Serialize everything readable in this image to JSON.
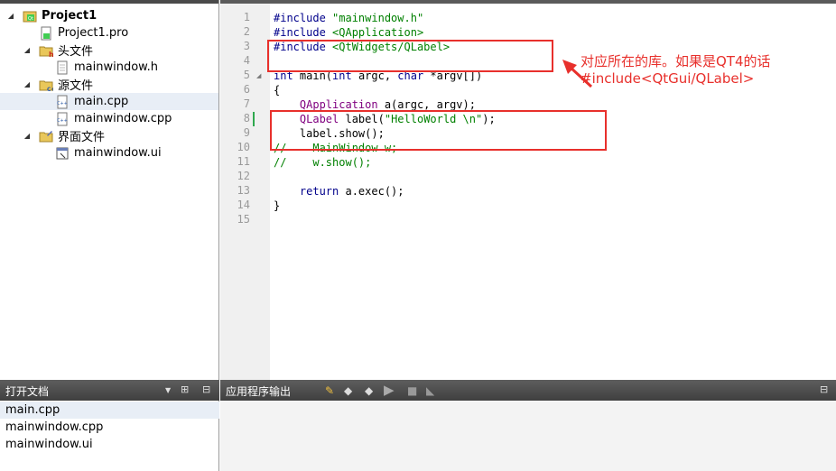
{
  "project_tree": {
    "items": [
      {
        "label": "Project1",
        "bold": true,
        "icon": "qt-project-icon"
      },
      {
        "label": "Project1.pro",
        "icon": "pro-file-icon"
      },
      {
        "label": "头文件",
        "icon": "header-folder-icon"
      },
      {
        "label": "mainwindow.h",
        "icon": "header-file-icon"
      },
      {
        "label": "源文件",
        "icon": "source-folder-icon"
      },
      {
        "label": "main.cpp",
        "icon": "cpp-file-icon"
      },
      {
        "label": "mainwindow.cpp",
        "icon": "cpp-file-icon"
      },
      {
        "label": "界面文件",
        "icon": "forms-folder-icon"
      },
      {
        "label": "mainwindow.ui",
        "icon": "ui-file-icon"
      }
    ]
  },
  "editor": {
    "line_numbers": [
      "1",
      "2",
      "3",
      "4",
      "5",
      "6",
      "7",
      "8",
      "9",
      "10",
      "11",
      "12",
      "13",
      "14",
      "15"
    ],
    "lines": [
      [
        {
          "t": "#include ",
          "c": "kw"
        },
        {
          "t": "\"mainwindow.h\"",
          "c": "str"
        }
      ],
      [
        {
          "t": "#include ",
          "c": "kw"
        },
        {
          "t": "<QApplication>",
          "c": "str"
        }
      ],
      [
        {
          "t": "#include ",
          "c": "kw"
        },
        {
          "t": "<QtWidgets/QLabel>",
          "c": "str"
        }
      ],
      [],
      [
        {
          "t": "int ",
          "c": "kw"
        },
        {
          "t": "main(",
          "c": "plain"
        },
        {
          "t": "int ",
          "c": "kw"
        },
        {
          "t": "argc, ",
          "c": "plain"
        },
        {
          "t": "char ",
          "c": "kw"
        },
        {
          "t": "*argv[])",
          "c": "plain"
        }
      ],
      [
        {
          "t": "{",
          "c": "plain"
        }
      ],
      [
        {
          "t": "    QApplication ",
          "c": "cls"
        },
        {
          "t": "a(argc, argv);",
          "c": "plain"
        }
      ],
      [
        {
          "t": "    QLabel ",
          "c": "cls"
        },
        {
          "t": "label(",
          "c": "plain"
        },
        {
          "t": "\"HelloWorld \\n\"",
          "c": "str"
        },
        {
          "t": ");",
          "c": "plain"
        }
      ],
      [
        {
          "t": "    label.show();",
          "c": "plain"
        }
      ],
      [
        {
          "t": "//    MainWindow w;",
          "c": "cmt"
        }
      ],
      [
        {
          "t": "//    w.show();",
          "c": "cmt"
        }
      ],
      [],
      [
        {
          "t": "    return ",
          "c": "kw"
        },
        {
          "t": "a.exec();",
          "c": "plain"
        }
      ],
      [
        {
          "t": "}",
          "c": "plain"
        }
      ],
      []
    ]
  },
  "annotation": {
    "line1": "对应所在的库。如果是QT4的话",
    "line2": "#include<QtGui/QLabel>"
  },
  "open_documents": {
    "title": "打开文档",
    "items": [
      "main.cpp",
      "mainwindow.cpp",
      "mainwindow.ui"
    ]
  },
  "output_panel": {
    "title": "应用程序输出"
  },
  "colors": {
    "annotation_red": "#e8302c",
    "keyword": "#00008b",
    "string": "#008000"
  }
}
